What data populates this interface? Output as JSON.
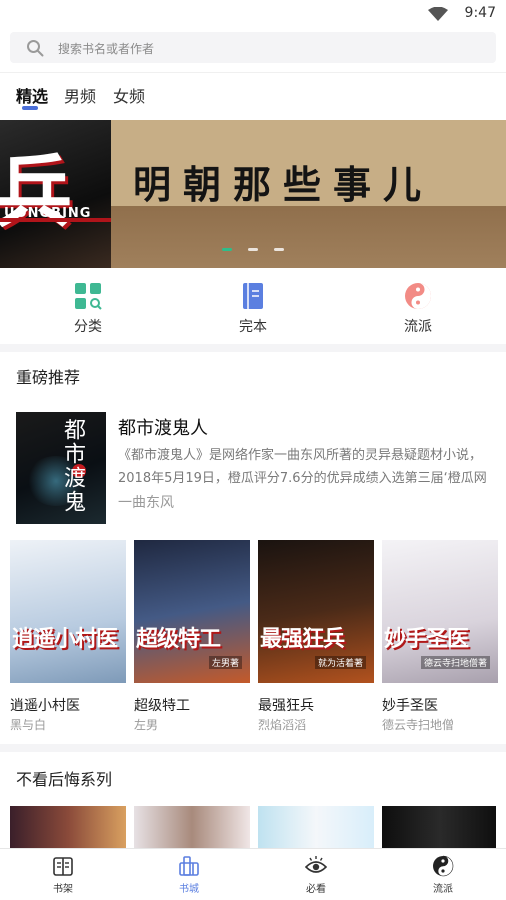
{
  "status_bar": {
    "time": "9:47"
  },
  "search": {
    "placeholder": "搜索书名或者作者"
  },
  "tabs": [
    {
      "label": "精选",
      "active": true
    },
    {
      "label": "男频",
      "active": false
    },
    {
      "label": "女频",
      "active": false
    }
  ],
  "banner": {
    "title": "明朝那些事儿",
    "left_text": "兵",
    "left_subtext": "UONGBING",
    "slides": 3,
    "active_slide": 1
  },
  "quick_links": [
    {
      "label": "分类",
      "icon": "grid-search-icon"
    },
    {
      "label": "完本",
      "icon": "book-icon"
    },
    {
      "label": "流派",
      "icon": "yin-yang-icon"
    }
  ],
  "recommend": {
    "title": "重磅推荐",
    "featured": {
      "name": "都市渡鬼人",
      "cover_text": "都市渡鬼",
      "desc": "《都市渡鬼人》是网络作家一曲东风所著的灵异悬疑题材小说，2018年5月19日，橙瓜评分7.6分的优异成绩入选第三届‘橙瓜网络…",
      "author": "一曲东风"
    },
    "books": [
      {
        "name": "逍遥小村医",
        "author": "黑与白",
        "cover_title": "逍遥小村医",
        "cover_author": "",
        "colors": [
          "#dfe6ee",
          "#9fb7d3"
        ]
      },
      {
        "name": "超级特工",
        "author": "左男",
        "cover_title": "超级特工",
        "cover_author": "左男著",
        "colors": [
          "#2a3550",
          "#8aa0c8"
        ]
      },
      {
        "name": "最强狂兵",
        "author": "烈焰滔滔",
        "cover_title": "最强狂兵",
        "cover_author": "就为活着著",
        "colors": [
          "#1b1411",
          "#6c3a20"
        ]
      },
      {
        "name": "妙手圣医",
        "author": "德云寺扫地僧",
        "cover_title": "妙手圣医",
        "cover_author": "德云寺扫地僧著",
        "colors": [
          "#f1f1f3",
          "#c9c3cc"
        ]
      }
    ]
  },
  "no_regret": {
    "title": "不看后悔系列"
  },
  "bottom_nav": [
    {
      "label": "书架",
      "icon": "bookshelf-icon",
      "active": false
    },
    {
      "label": "书城",
      "icon": "bookstore-icon",
      "active": true
    },
    {
      "label": "必看",
      "icon": "eye-icon",
      "active": false
    },
    {
      "label": "流派",
      "icon": "yin-yang-icon",
      "active": false
    }
  ]
}
